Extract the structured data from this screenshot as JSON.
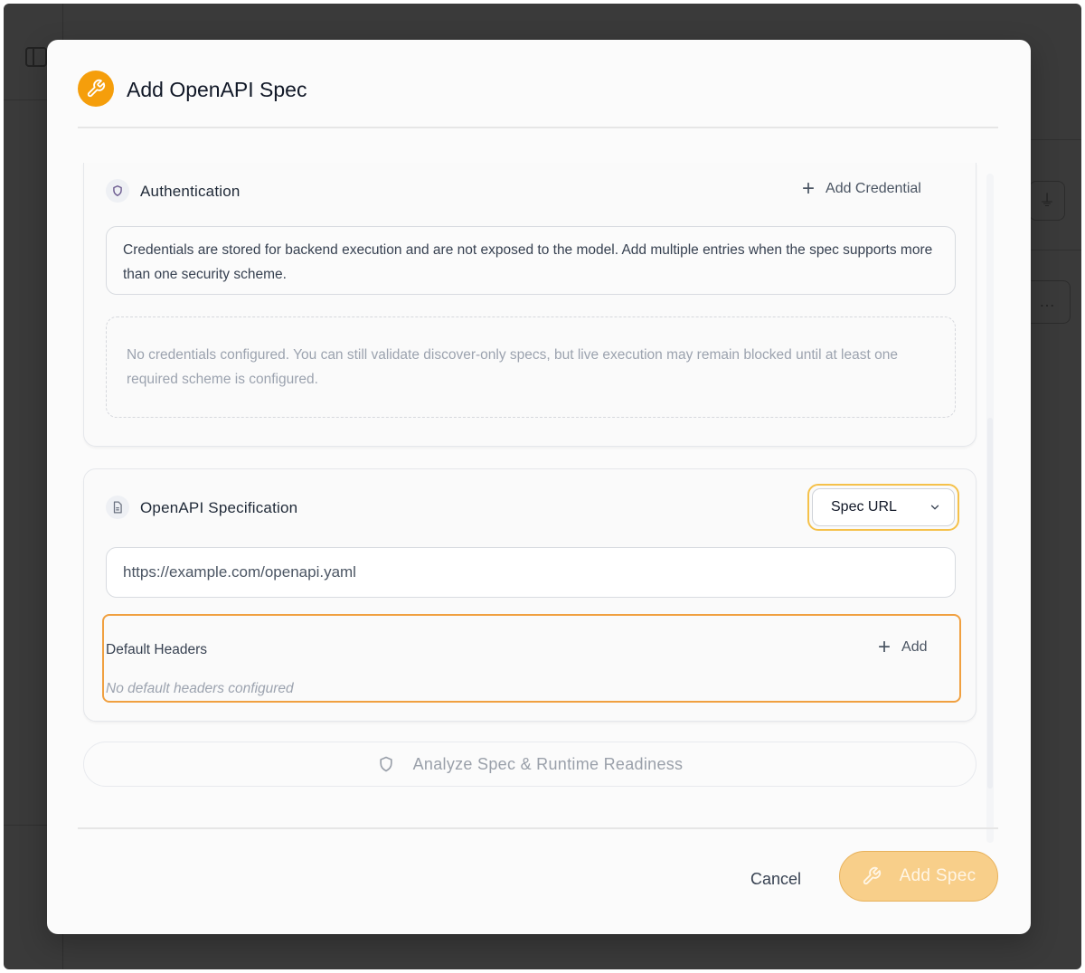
{
  "modal": {
    "title": "Add OpenAPI Spec",
    "header_icon": "wrench-icon"
  },
  "authentication": {
    "title": "Authentication",
    "icon": "shield-icon",
    "add_label": "Add Credential",
    "info": "Credentials are stored for backend execution and are not exposed to the model. Add multiple entries when the spec supports more than one security scheme.",
    "empty": "No credentials configured. You can still validate discover-only specs, but live execution may remain blocked until at least one required scheme is configured."
  },
  "spec": {
    "title": "OpenAPI Specification",
    "icon": "document-icon",
    "source_selected": "Spec URL",
    "url_value": "https://example.com/openapi.yaml",
    "headers_label": "Default Headers",
    "headers_add_label": "Add",
    "headers_empty": "No default headers configured"
  },
  "analyze_label": "Analyze Spec & Runtime Readiness",
  "footer": {
    "cancel_label": "Cancel",
    "submit_label": "Add Spec"
  },
  "colors": {
    "accent": "#f59e0b",
    "focus_ring": "#f5c14a",
    "highlight": "#f0a040",
    "primary_disabled": "#f8cf8a"
  }
}
